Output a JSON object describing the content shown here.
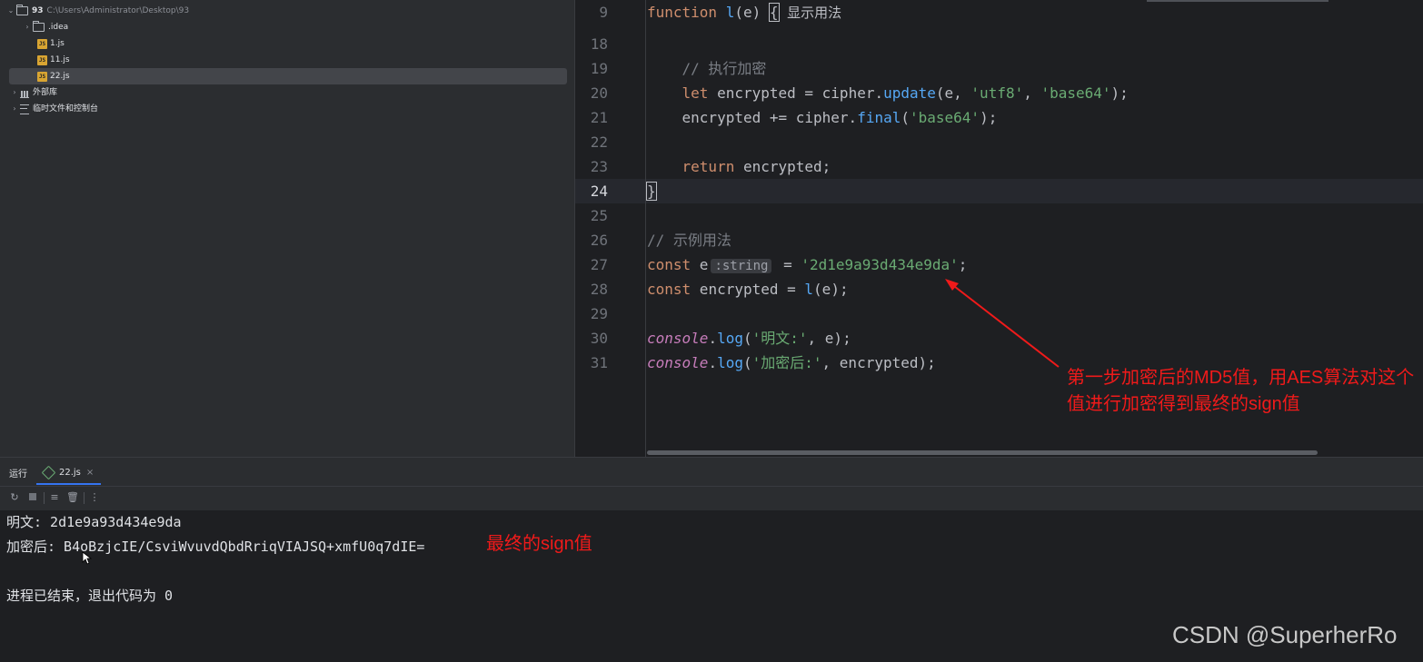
{
  "project_tree": {
    "root": {
      "name": "93",
      "path": "C:\\Users\\Administrator\\Desktop\\93"
    },
    "items": [
      {
        "label": ".idea"
      },
      {
        "label": "1.js"
      },
      {
        "label": "11.js"
      },
      {
        "label": "22.js"
      }
    ],
    "external_libs": "外部库",
    "scratches": "临时文件和控制台"
  },
  "editor": {
    "lines": [
      {
        "num": "9",
        "html": "<span class=\"kw\">function</span> <span class=\"fn\">l</span>(e) <span class=\"cursor-box\">{</span> <span class=\"hint\">显示用法</span>"
      },
      {
        "num": "18",
        "html": ""
      },
      {
        "num": "19",
        "html": "    <span class=\"cmt\">// 执行加密</span>"
      },
      {
        "num": "20",
        "html": "    <span class=\"kw\">let</span> encrypted = cipher.<span class=\"fn\">update</span>(e, <span class=\"str\">'utf8'</span>, <span class=\"str\">'base64'</span>);"
      },
      {
        "num": "21",
        "html": "    encrypted += cipher.<span class=\"fn\">final</span>(<span class=\"str\">'base64'</span>);"
      },
      {
        "num": "22",
        "html": ""
      },
      {
        "num": "23",
        "html": "    <span class=\"kw\">return</span> encrypted;"
      },
      {
        "num": "24",
        "html": "<span class=\"cursor-box\">}</span>"
      },
      {
        "num": "25",
        "html": ""
      },
      {
        "num": "26",
        "html": "<span class=\"cmt\">// 示例用法</span>"
      },
      {
        "num": "27",
        "html": "<span class=\"kw\">const</span> e<span class=\"inlay\">:string</span> = <span class=\"str\">'2d1e9a93d434e9da'</span>;"
      },
      {
        "num": "28",
        "html": "<span class=\"kw\">const</span> encrypted = <span class=\"fn\">l</span>(e);"
      },
      {
        "num": "29",
        "html": ""
      },
      {
        "num": "30",
        "html": "<span class=\"ital\">console</span>.<span class=\"fn\">log</span>(<span class=\"str\">'明文:'</span>, e);"
      },
      {
        "num": "31",
        "html": "<span class=\"ital\">console</span>.<span class=\"fn\">log</span>(<span class=\"str\">'加密后:'</span>, encrypted);"
      }
    ],
    "current_line": "24"
  },
  "annotation": {
    "text": "第一步加密后的MD5值，用AES算法对这个值进行加密得到最终的sign值",
    "sign_note": "最终的sign值",
    "color": "#f01a1a"
  },
  "run_panel": {
    "title": "运行",
    "tab_label": "22.js",
    "output": [
      "明文: 2d1e9a93d434e9da",
      "加密后: B4oBzjcIE/CsviWvuvdQbdRriqVIAJSQ+xmfU0q7dIE=",
      "",
      "进程已结束，退出代码为 0"
    ]
  },
  "watermark": "CSDN @SuperherRo"
}
